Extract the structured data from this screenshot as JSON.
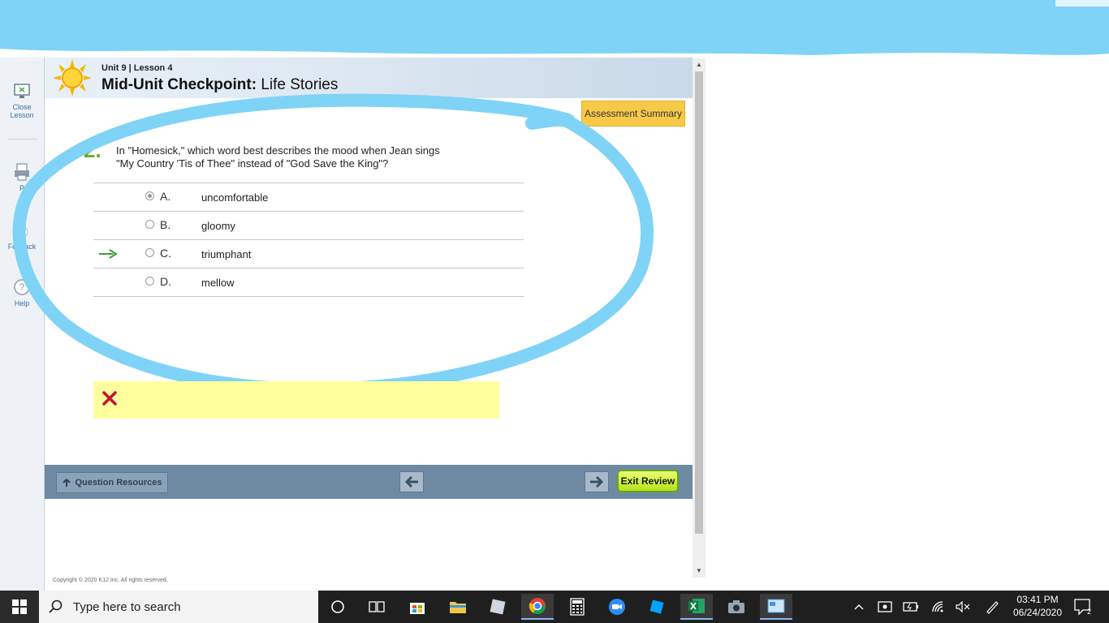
{
  "sidebar": {
    "close_label_1": "Close",
    "close_label_2": "Lesson",
    "print_label": "P",
    "feedback_label": "Fe    ack",
    "help_label": "Help"
  },
  "header": {
    "unit_line": "Unit 9 | Lesson 4",
    "title_bold": "Mid-Unit Checkpoint:",
    "title_rest": "Life Stories"
  },
  "assessment_summary_label": "Assessment Summary",
  "question": {
    "number": "2.",
    "text_line1": "In \"Homesick,\" which word best describes the mood when Jean sings",
    "text_line2": "\"My Country 'Tis of Thee\" instead of \"God Save the King\"?",
    "answers": [
      {
        "letter": "A.",
        "text": "uncomfortable",
        "selected": true,
        "correct": false
      },
      {
        "letter": "B.",
        "text": "gloomy",
        "selected": false,
        "correct": false
      },
      {
        "letter": "C.",
        "text": "triumphant",
        "selected": false,
        "correct": true
      },
      {
        "letter": "D.",
        "text": "mellow",
        "selected": false,
        "correct": false
      }
    ]
  },
  "footer": {
    "question_resources_label": "Question Resources",
    "exit_review_label": "Exit Review",
    "copyright": "Copyright © 2020 K12 Inc. All rights reserved."
  },
  "taskbar": {
    "search_placeholder": "Type here to search",
    "time": "03:41 PM",
    "date": "06/24/2020",
    "notification_count": "2"
  },
  "colors": {
    "scribble": "#7fd3f7",
    "question_number": "#6aab2c",
    "assessment_btn": "#f7c948",
    "feedback_bg": "#ffff9e",
    "footer_bar": "#6e8aa3",
    "exit_btn": "#b7e21c",
    "correct_arrow": "#3a9a3a",
    "wrong_mark": "#c8102e"
  }
}
